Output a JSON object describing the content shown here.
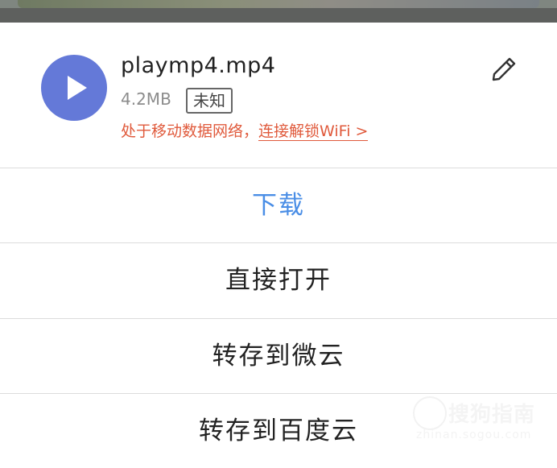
{
  "file": {
    "name": "playmp4.mp4",
    "size": "4.2MB",
    "type_badge": "未知",
    "network_notice": "处于移动数据网络，",
    "network_link": "连接解锁WiFi >"
  },
  "actions": {
    "download": "下载",
    "open_directly": "直接打开",
    "save_to_weiyun": "转存到微云",
    "save_to_baidu": "转存到百度云"
  },
  "watermark": {
    "brand": "搜狗指南",
    "url": "zhinan.sogou.com"
  },
  "colors": {
    "accent_blue": "#4a8ee6",
    "play_circle": "#6479d8",
    "notice_red": "#e05a3c"
  },
  "icons": {
    "play": "play-icon",
    "edit": "pencil-icon"
  }
}
